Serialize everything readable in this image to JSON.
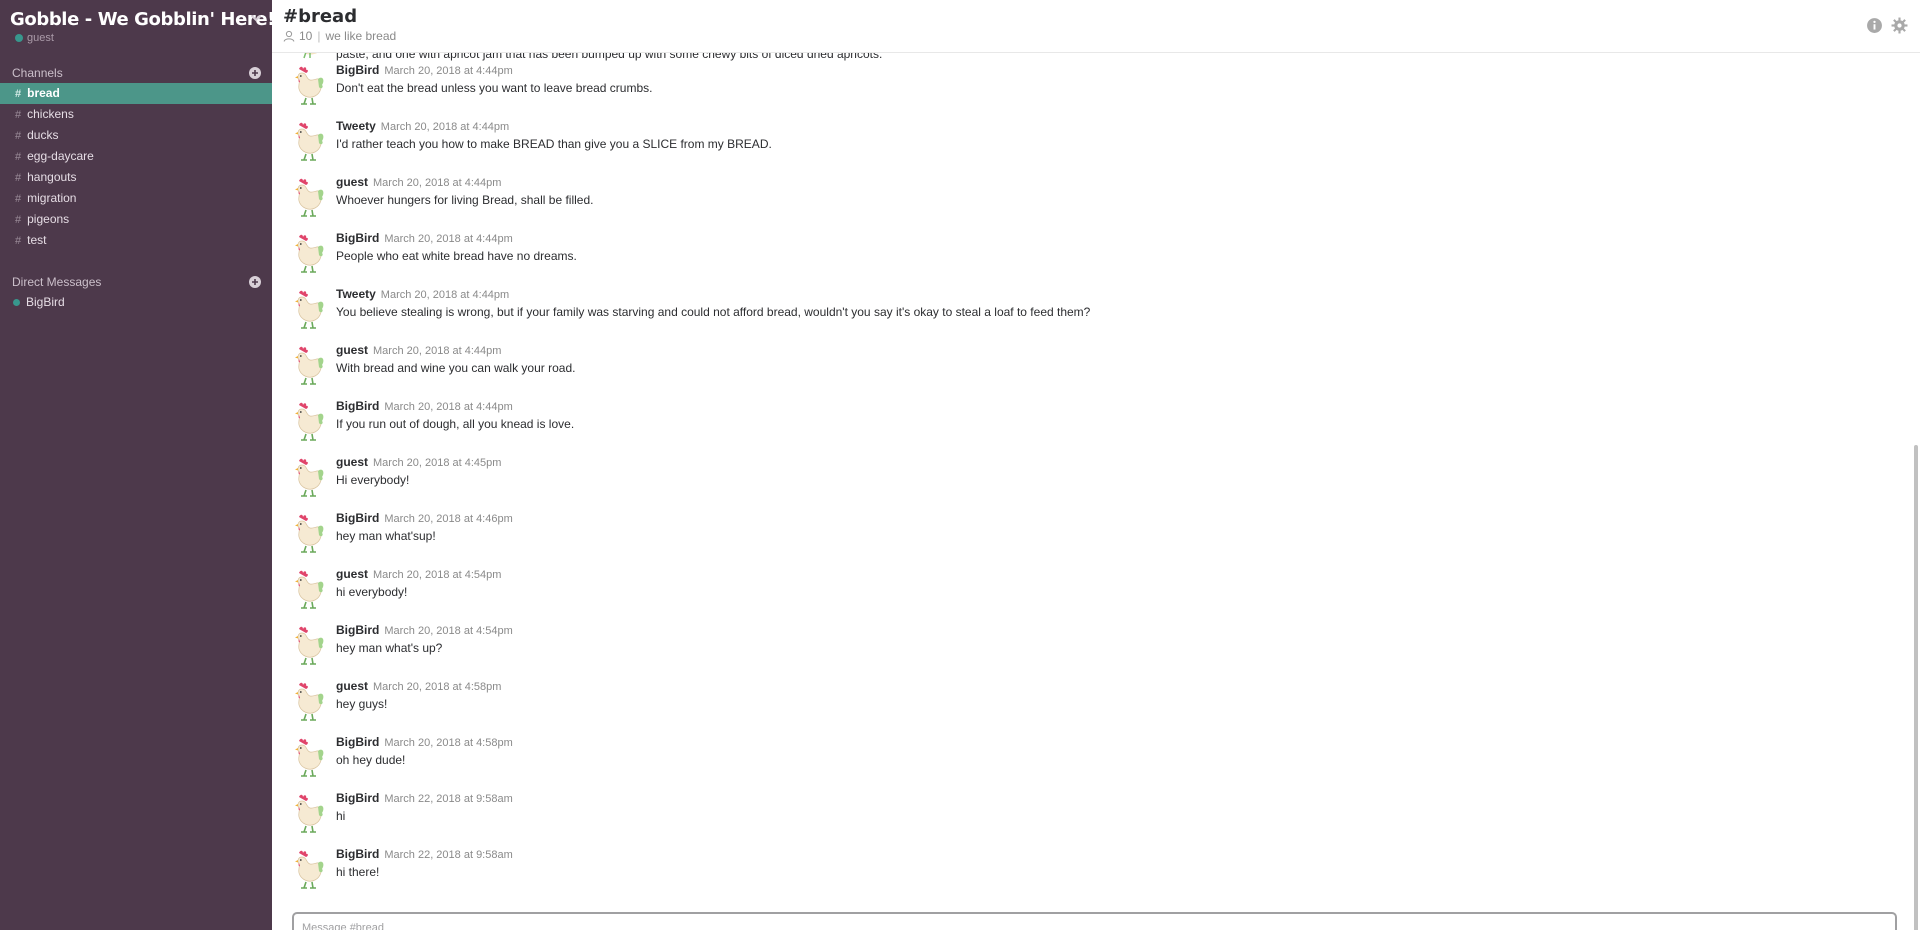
{
  "team": {
    "name": "Gobble - We Gobblin' Here!",
    "current_user": "guest"
  },
  "sidebar": {
    "channels_label": "Channels",
    "channels": [
      {
        "name": "bread",
        "active": true
      },
      {
        "name": "chickens"
      },
      {
        "name": "ducks"
      },
      {
        "name": "egg-daycare"
      },
      {
        "name": "hangouts"
      },
      {
        "name": "migration"
      },
      {
        "name": "pigeons"
      },
      {
        "name": "test"
      }
    ],
    "dm_label": "Direct Messages",
    "direct_messages": [
      {
        "name": "BigBird"
      }
    ]
  },
  "header": {
    "title": "#bread",
    "member_count": "10",
    "purpose": "we like bread"
  },
  "partial_message": "paste, and one with apricot jam that has been bumped up with some chewy bits of diced dried apricots.",
  "messages": [
    {
      "author": "BigBird",
      "time": "March 20, 2018 at 4:44pm",
      "text": "Don't eat the bread unless you want to leave bread crumbs."
    },
    {
      "author": "Tweety",
      "time": "March 20, 2018 at 4:44pm",
      "text": "I'd rather teach you how to make BREAD than give you a SLICE from my BREAD."
    },
    {
      "author": "guest",
      "time": "March 20, 2018 at 4:44pm",
      "text": "Whoever hungers for living Bread, shall be filled."
    },
    {
      "author": "BigBird",
      "time": "March 20, 2018 at 4:44pm",
      "text": "People who eat white bread have no dreams."
    },
    {
      "author": "Tweety",
      "time": "March 20, 2018 at 4:44pm",
      "text": "You believe stealing is wrong, but if your family was starving and could not afford bread, wouldn't you say it's okay to steal a loaf to feed them?"
    },
    {
      "author": "guest",
      "time": "March 20, 2018 at 4:44pm",
      "text": "With bread and wine you can walk your road."
    },
    {
      "author": "BigBird",
      "time": "March 20, 2018 at 4:44pm",
      "text": "If you run out of dough, all you knead is love."
    },
    {
      "author": "guest",
      "time": "March 20, 2018 at 4:45pm",
      "text": "Hi everybody!"
    },
    {
      "author": "BigBird",
      "time": "March 20, 2018 at 4:46pm",
      "text": "hey man what'sup!"
    },
    {
      "author": "guest",
      "time": "March 20, 2018 at 4:54pm",
      "text": "hi everybody!"
    },
    {
      "author": "BigBird",
      "time": "March 20, 2018 at 4:54pm",
      "text": "hey man what's up?"
    },
    {
      "author": "guest",
      "time": "March 20, 2018 at 4:58pm",
      "text": "hey guys!"
    },
    {
      "author": "BigBird",
      "time": "March 20, 2018 at 4:58pm",
      "text": "oh hey dude!"
    },
    {
      "author": "BigBird",
      "time": "March 22, 2018 at 9:58am",
      "text": "hi"
    },
    {
      "author": "BigBird",
      "time": "March 22, 2018 at 9:58am",
      "text": "hi there!"
    }
  ],
  "composer": {
    "placeholder": "Message #bread"
  },
  "colors": {
    "sidebar_bg": "#4d394b",
    "active_channel": "#4c9689",
    "presence": "#38978d"
  },
  "icons": {
    "team_menu": "chevron-down-icon",
    "add": "plus-circle-icon",
    "member": "user-icon",
    "info": "info-icon",
    "settings": "gear-icon",
    "avatar": "rooster-icon"
  }
}
